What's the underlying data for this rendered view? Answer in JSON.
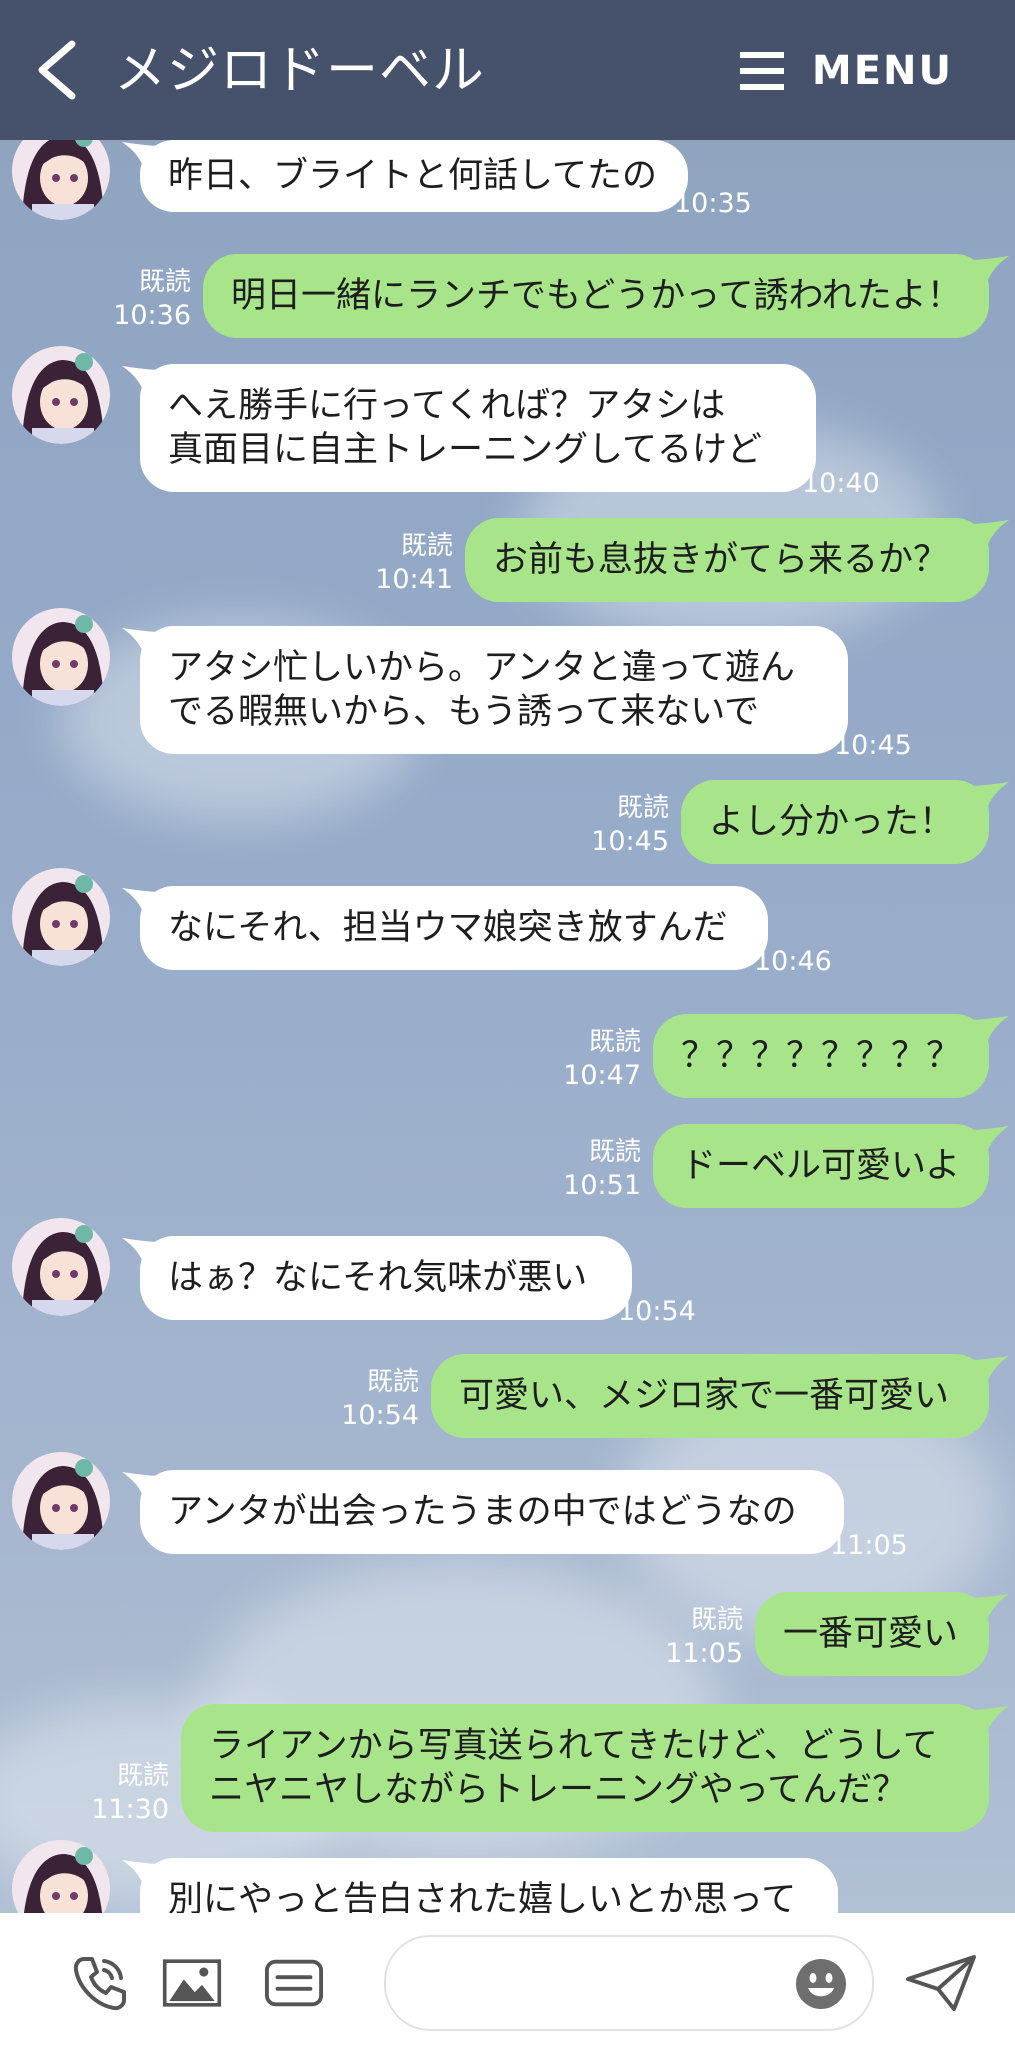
{
  "header": {
    "title": "メジロドーベル",
    "menu_label": "MENU"
  },
  "messages": [
    {
      "side": "in",
      "lines": [
        "昨日、ブライトと何話してたの"
      ],
      "time": "10:35"
    },
    {
      "side": "out",
      "lines": [
        "明日一緒にランチでもどうかって誘われたよ！"
      ],
      "read": "既読",
      "time": "10:36"
    },
    {
      "side": "in",
      "lines": [
        "へえ勝手に行ってくれば？アタシは",
        "真面目に自主トレーニングしてるけど"
      ],
      "time": "10:40"
    },
    {
      "side": "out",
      "lines": [
        "お前も息抜きがてら来るか？"
      ],
      "read": "既読",
      "time": "10:41"
    },
    {
      "side": "in",
      "lines": [
        "アタシ忙しいから。アンタと違って遊ん",
        "でる暇無いから、もう誘って来ないで"
      ],
      "time": "10:45"
    },
    {
      "side": "out",
      "lines": [
        "よし分かった！"
      ],
      "read": "既読",
      "time": "10:45"
    },
    {
      "side": "in",
      "lines": [
        "なにそれ、担当ウマ娘突き放すんだ"
      ],
      "time": "10:46"
    },
    {
      "side": "out",
      "lines": [
        "？？？？？？？？"
      ],
      "read": "既読",
      "time": "10:47"
    },
    {
      "side": "out",
      "lines": [
        "ドーベル可愛いよ"
      ],
      "read": "既読",
      "time": "10:51"
    },
    {
      "side": "in",
      "lines": [
        "はぁ？なにそれ気味が悪い"
      ],
      "time": "10:54"
    },
    {
      "side": "out",
      "lines": [
        "可愛い、メジロ家で一番可愛い"
      ],
      "read": "既読",
      "time": "10:54"
    },
    {
      "side": "in",
      "lines": [
        "アンタが出会ったうまの中ではどうなの"
      ],
      "time": "11:05"
    },
    {
      "side": "out",
      "lines": [
        "一番可愛い"
      ],
      "read": "既読",
      "time": "11:05"
    },
    {
      "side": "out",
      "lines": [
        "ライアンから写真送られてきたけど、どうして",
        "ニヤニヤしながらトレーニングやってんだ？"
      ],
      "read": "既読",
      "time": "11:30"
    },
    {
      "side": "in",
      "lines": [
        "別にやっと告白された嬉しいとか思って"
      ],
      "time": ""
    }
  ],
  "footer": {
    "input_value": "",
    "icons": [
      "phone-icon",
      "image-icon",
      "keyboard-icon",
      "emoji-icon",
      "send-icon"
    ]
  },
  "colors": {
    "header": "#46516b",
    "outgoing_bubble": "#a8e58a",
    "incoming_bubble": "#ffffff"
  }
}
